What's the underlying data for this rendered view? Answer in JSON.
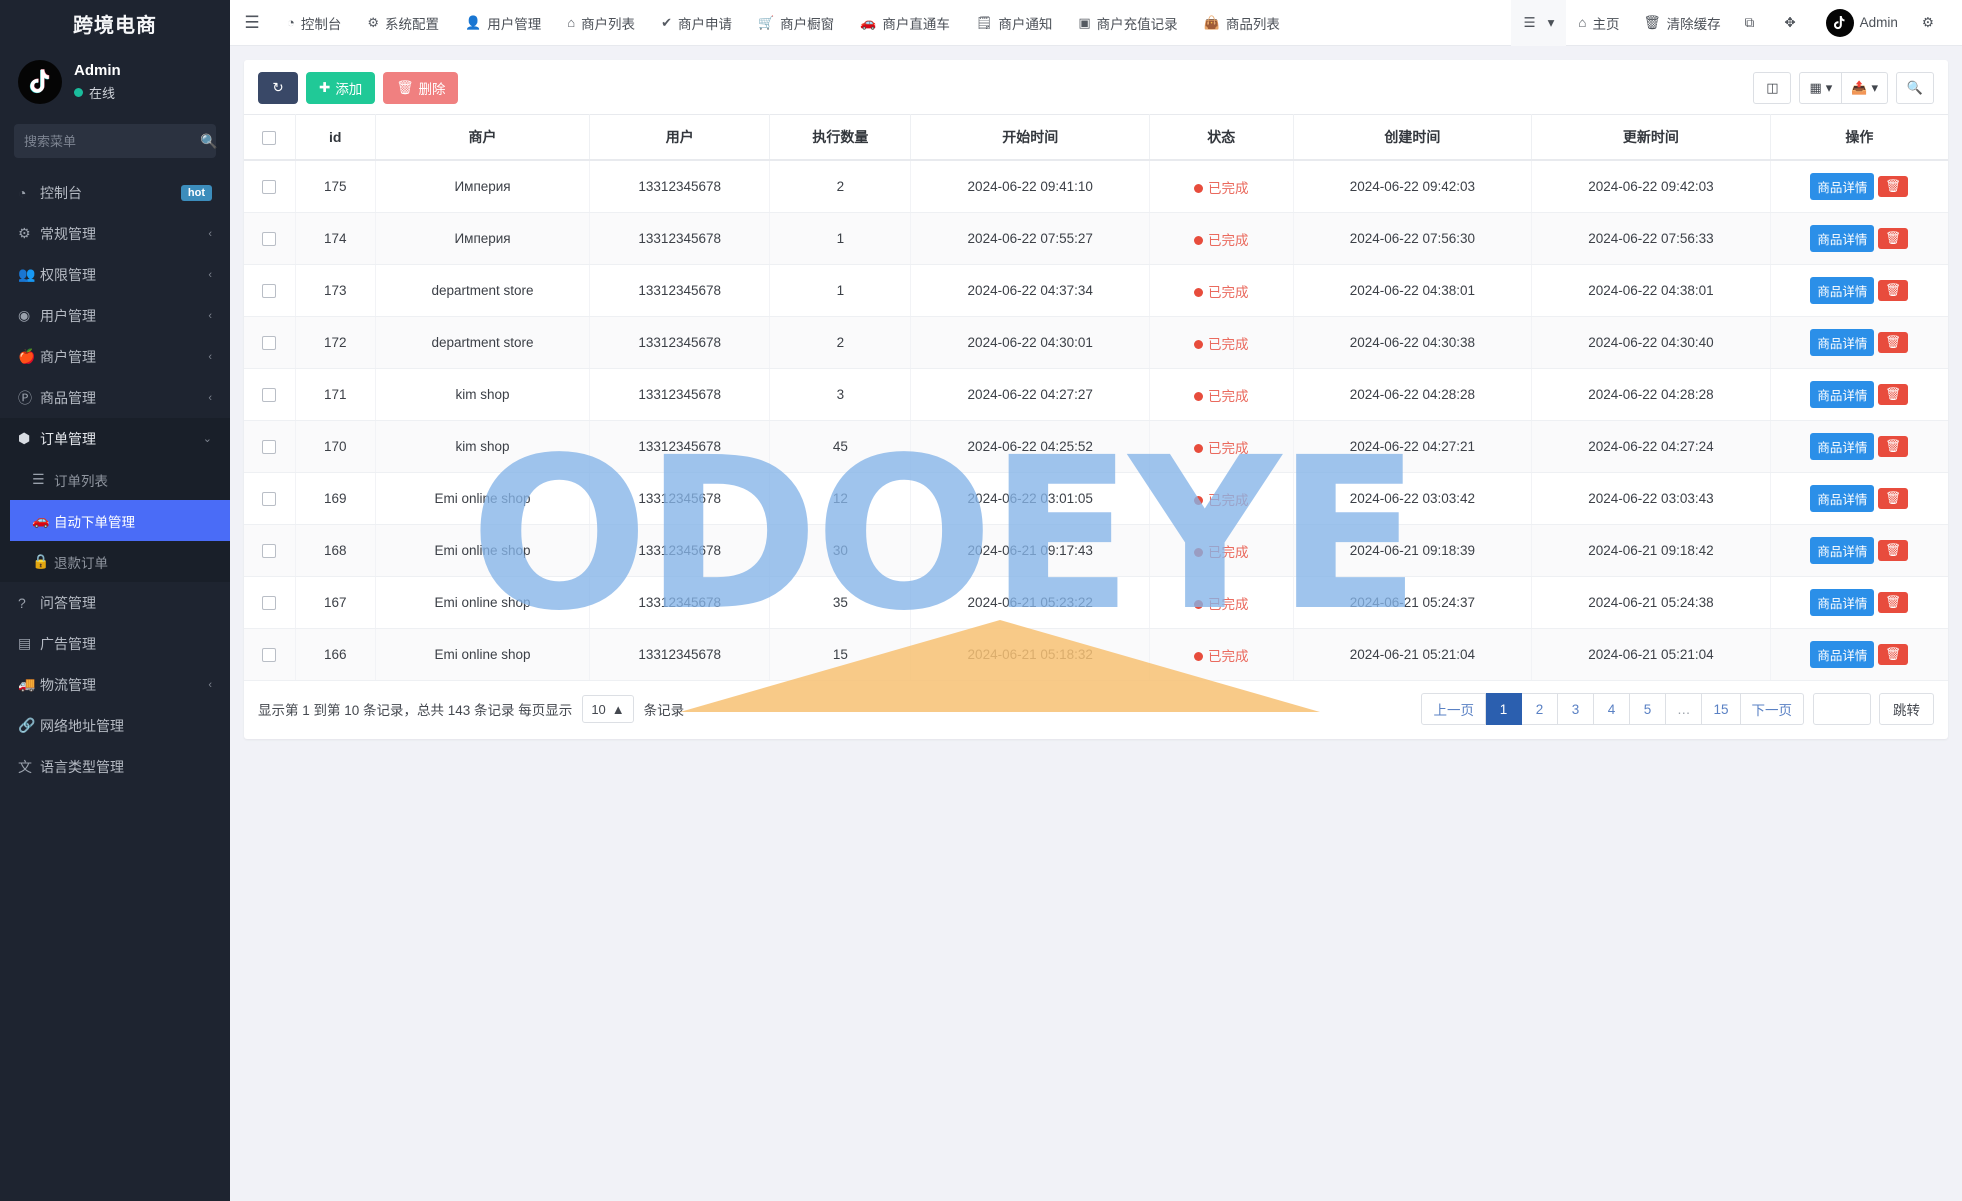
{
  "sidebar": {
    "brand": "跨境电商",
    "profile": {
      "name": "Admin",
      "status": "在线",
      "avatar_icon": "tiktok-logo-icon"
    },
    "search": {
      "placeholder": "搜索菜单",
      "value": "",
      "icon": "search-icon"
    },
    "items": [
      {
        "label": "控制台",
        "icon": "dashboard-icon",
        "badge": "hot",
        "caret": ""
      },
      {
        "label": "常规管理",
        "icon": "cogs-icon",
        "badge": "",
        "caret": "‹"
      },
      {
        "label": "权限管理",
        "icon": "users-icon",
        "badge": "",
        "caret": "‹"
      },
      {
        "label": "用户管理",
        "icon": "user-circle-icon",
        "badge": "",
        "caret": "‹"
      },
      {
        "label": "商户管理",
        "icon": "apple-icon",
        "badge": "",
        "caret": "‹"
      },
      {
        "label": "商品管理",
        "icon": "product-icon",
        "badge": "",
        "caret": "‹"
      },
      {
        "label": "订单管理",
        "icon": "cube-icon",
        "badge": "",
        "caret": "⌄"
      }
    ],
    "sub_items": [
      {
        "label": "订单列表",
        "icon": "list-icon",
        "active": false
      },
      {
        "label": "自动下单管理",
        "icon": "car-icon",
        "active": true
      },
      {
        "label": "退款订单",
        "icon": "lock-icon",
        "active": false
      }
    ],
    "items_after": [
      {
        "label": "问答管理",
        "icon": "question-circle-icon",
        "badge": "",
        "caret": ""
      },
      {
        "label": "广告管理",
        "icon": "ad-icon",
        "badge": "",
        "caret": ""
      },
      {
        "label": "物流管理",
        "icon": "truck-icon",
        "badge": "",
        "caret": "‹"
      },
      {
        "label": "网络地址管理",
        "icon": "link-icon",
        "badge": "",
        "caret": ""
      },
      {
        "label": "语言类型管理",
        "icon": "language-icon",
        "badge": "",
        "caret": ""
      }
    ]
  },
  "topbar": {
    "hamburger_icon": "hamburger-icon",
    "nav": [
      {
        "label": "控制台",
        "icon": "dashboard-icon"
      },
      {
        "label": "系统配置",
        "icon": "gear-icon"
      },
      {
        "label": "用户管理",
        "icon": "user-icon"
      },
      {
        "label": "商户列表",
        "icon": "home-icon"
      },
      {
        "label": "商户申请",
        "icon": "check-circle-icon"
      },
      {
        "label": "商户橱窗",
        "icon": "cart-icon"
      },
      {
        "label": "商户直通车",
        "icon": "car-icon"
      },
      {
        "label": "商户通知",
        "icon": "note-icon"
      },
      {
        "label": "商户充值记录",
        "icon": "money-icon"
      },
      {
        "label": "商品列表",
        "icon": "bag-icon"
      }
    ],
    "right": [
      {
        "label": "",
        "icon": "list-menu-icon",
        "caret": "▾"
      },
      {
        "label": "主页",
        "icon": "home-icon"
      },
      {
        "label": "清除缓存",
        "icon": "trash-icon"
      },
      {
        "label": "",
        "icon": "copy-icon"
      },
      {
        "label": "",
        "icon": "fullscreen-icon"
      },
      {
        "label": "Admin",
        "icon": "tiktok-logo-icon"
      },
      {
        "label": "",
        "icon": "gear-settings-icon"
      }
    ]
  },
  "toolbar": {
    "refresh_icon": "refresh-icon",
    "add_label": "添加",
    "add_icon": "plus-icon",
    "delete_label": "删除",
    "delete_icon": "trash-icon",
    "right_buttons": [
      {
        "icon": "columns-list-icon",
        "caret": ""
      },
      {
        "icon": "grid-icon",
        "caret": "▾"
      },
      {
        "icon": "export-icon",
        "caret": "▾"
      },
      {
        "icon": "search-icon",
        "caret": ""
      }
    ]
  },
  "table": {
    "columns": [
      "",
      "id",
      "商户",
      "用户",
      "执行数量",
      "开始时间",
      "状态",
      "创建时间",
      "更新时间",
      "操作"
    ],
    "row_action": {
      "detail_label": "商品详情",
      "delete_icon": "trash-icon"
    },
    "rows": [
      {
        "id": "175",
        "merchant": "Империя",
        "user": "13312345678",
        "qty": "2",
        "start": "2024-06-22 09:41:10",
        "status": "已完成",
        "created": "2024-06-22 09:42:03",
        "updated": "2024-06-22 09:42:03"
      },
      {
        "id": "174",
        "merchant": "Империя",
        "user": "13312345678",
        "qty": "1",
        "start": "2024-06-22 07:55:27",
        "status": "已完成",
        "created": "2024-06-22 07:56:30",
        "updated": "2024-06-22 07:56:33"
      },
      {
        "id": "173",
        "merchant": "department store",
        "user": "13312345678",
        "qty": "1",
        "start": "2024-06-22 04:37:34",
        "status": "已完成",
        "created": "2024-06-22 04:38:01",
        "updated": "2024-06-22 04:38:01"
      },
      {
        "id": "172",
        "merchant": "department store",
        "user": "13312345678",
        "qty": "2",
        "start": "2024-06-22 04:30:01",
        "status": "已完成",
        "created": "2024-06-22 04:30:38",
        "updated": "2024-06-22 04:30:40"
      },
      {
        "id": "171",
        "merchant": "kim shop",
        "user": "13312345678",
        "qty": "3",
        "start": "2024-06-22 04:27:27",
        "status": "已完成",
        "created": "2024-06-22 04:28:28",
        "updated": "2024-06-22 04:28:28"
      },
      {
        "id": "170",
        "merchant": "kim shop",
        "user": "13312345678",
        "qty": "45",
        "start": "2024-06-22 04:25:52",
        "status": "已完成",
        "created": "2024-06-22 04:27:21",
        "updated": "2024-06-22 04:27:24"
      },
      {
        "id": "169",
        "merchant": "Emi online shop",
        "user": "13312345678",
        "qty": "12",
        "start": "2024-06-22 03:01:05",
        "status": "已完成",
        "created": "2024-06-22 03:03:42",
        "updated": "2024-06-22 03:03:43"
      },
      {
        "id": "168",
        "merchant": "Emi online shop",
        "user": "13312345678",
        "qty": "30",
        "start": "2024-06-21 09:17:43",
        "status": "已完成",
        "created": "2024-06-21 09:18:39",
        "updated": "2024-06-21 09:18:42"
      },
      {
        "id": "167",
        "merchant": "Emi online shop",
        "user": "13312345678",
        "qty": "35",
        "start": "2024-06-21 05:23:22",
        "status": "已完成",
        "created": "2024-06-21 05:24:37",
        "updated": "2024-06-21 05:24:38"
      },
      {
        "id": "166",
        "merchant": "Emi online shop",
        "user": "13312345678",
        "qty": "15",
        "start": "2024-06-21 05:18:32",
        "status": "已完成",
        "created": "2024-06-21 05:21:04",
        "updated": "2024-06-21 05:21:04"
      }
    ]
  },
  "pager": {
    "info_prefix": "显示第 1 到第 10 条记录，总共 143 条记录 每页显示",
    "page_size": "10",
    "page_size_caret": "▲",
    "info_suffix": "条记录",
    "prev_label": "上一页",
    "next_label": "下一页",
    "pages": [
      "1",
      "2",
      "3",
      "4",
      "5",
      "…",
      "15"
    ],
    "active_page": "1",
    "jump_value": "",
    "jump_label": "跳转"
  },
  "watermark": {
    "text": "ODOEYE"
  },
  "colors": {
    "sidebar_bg": "#1e2430",
    "accent_active": "#4a6cf7",
    "add_green": "#20c997",
    "delete_red": "#f08080",
    "detail_blue": "#2b8fe8",
    "status_red": "#e74c3c",
    "page_active": "#2b5faf",
    "watermark_blue": "#85b4e8",
    "watermark_orange": "#f7c173"
  }
}
